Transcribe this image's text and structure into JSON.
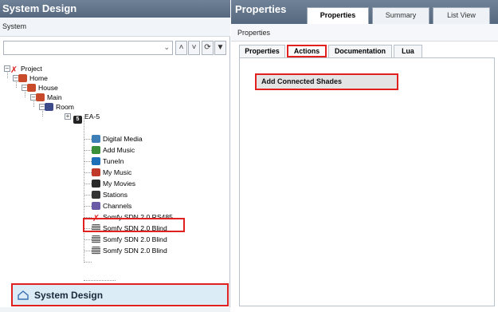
{
  "left_pane": {
    "title": "System Design",
    "subtitle": "System",
    "combo_value": "",
    "tree": [
      {
        "label": "Project",
        "icon": "project-icon"
      },
      {
        "label": "Home",
        "icon": "home-icon"
      },
      {
        "label": "House",
        "icon": "house-icon"
      },
      {
        "label": "Main",
        "icon": "main-icon"
      },
      {
        "label": "Room",
        "icon": "room-icon"
      },
      {
        "label": "EA-5",
        "icon": "ea5-icon"
      },
      {
        "label": "Digital Media",
        "icon": "digital-media-icon"
      },
      {
        "label": "Add Music",
        "icon": "add-music-icon"
      },
      {
        "label": "TuneIn",
        "icon": "tunein-icon"
      },
      {
        "label": "My Music",
        "icon": "my-music-icon"
      },
      {
        "label": "My Movies",
        "icon": "my-movies-icon"
      },
      {
        "label": "Stations",
        "icon": "stations-icon"
      },
      {
        "label": "Channels",
        "icon": "channels-icon"
      },
      {
        "label": "Somfy SDN 2.0 RS485",
        "icon": "somfy-driver-icon"
      },
      {
        "label": "Somfy SDN 2.0 Blind",
        "icon": "blind-icon"
      },
      {
        "label": "Somfy SDN 2.0 Blind",
        "icon": "blind-icon"
      },
      {
        "label": "Somfy SDN 2.0 Blind",
        "icon": "blind-icon"
      }
    ],
    "bottom_tab": "System Design"
  },
  "right_pane": {
    "title": "Properties",
    "top_tabs": [
      "Properties",
      "Summary",
      "List View"
    ],
    "active_top_tab": "Properties",
    "subheader": "Properties",
    "inner_tabs": [
      "Properties",
      "Actions",
      "Documentation",
      "Lua"
    ],
    "active_inner_tab": "Actions",
    "action_button": "Add Connected Shades"
  },
  "colors": {
    "header": "#56687e",
    "highlight": "#e0211f",
    "bottom_tab_bg": "#dcecf7"
  }
}
